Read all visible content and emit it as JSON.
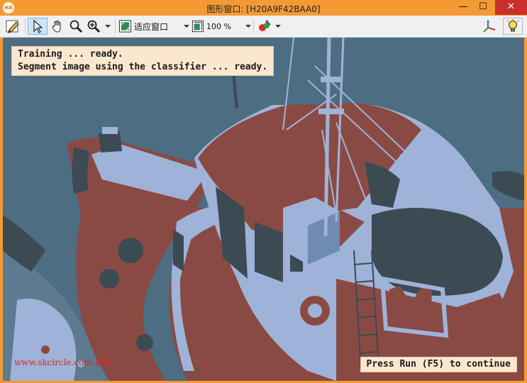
{
  "window": {
    "title": "图形窗口: [H20A9F42BAA0]",
    "app_icon_text": "HA",
    "buttons": {
      "minimize": "—",
      "maximize": "☐",
      "close": "✕"
    }
  },
  "toolbar": {
    "fit_label": "适应窗口",
    "zoom_label": "100 %"
  },
  "canvas": {
    "message_lines": [
      "Training ... ready.",
      "Segment image using the classifier ... ready."
    ],
    "continue_message": "Press Run (F5) to continue",
    "watermark": "www.skcircle.com 勇哥"
  },
  "colors": {
    "frame": "#f49a35",
    "hull_red": "#8a4a44",
    "light_blue": "#9fb3d8",
    "dark_slate": "#3c4a54",
    "water": "#4d6d82",
    "message_bg": "#fbe7cf"
  }
}
